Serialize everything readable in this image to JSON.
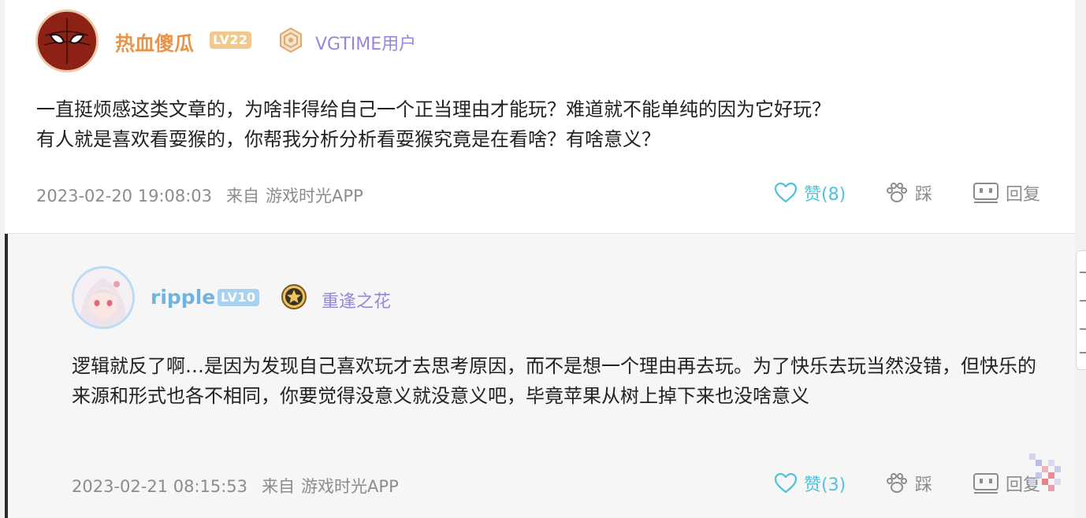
{
  "comments": [
    {
      "username": "热血傻瓜",
      "level": "LV22",
      "group": "VGTIME用户",
      "content": [
        "一直挺烦感这类文章的，为啥非得给自己一个正当理由才能玩？难道就不能单纯的因为它好玩？",
        "有人就是喜欢看耍猴的，你帮我分析分析看耍猴究竟是在看啥？有啥意义？"
      ],
      "timestamp": "2023-02-20 19:08:03",
      "source_prefix": "来自",
      "source_app": "游戏时光APP",
      "like_label": "赞(8)",
      "stamp_label": "踩",
      "reply_label": "回复"
    }
  ],
  "reply": {
    "username": "ripple",
    "level": "LV10",
    "group": "重逢之花",
    "content": "逻辑就反了啊…是因为发现自己喜欢玩才去思考原因，而不是想一个理由再去玩。为了快乐去玩当然没错，但快乐的来源和形式也各不相同，你要觉得没意义就没意义吧，毕竟苹果从树上掉下来也没啥意义",
    "timestamp": "2023-02-21 08:15:53",
    "source_prefix": "来自",
    "source_app": "游戏时光APP",
    "like_label": "赞(3)",
    "stamp_label": "踩",
    "reply_label": "回复"
  },
  "icons": {
    "like": "heart-outline-icon",
    "stamp": "paw-icon",
    "reply": "comment-box-icon"
  },
  "colors": {
    "main_username": "#e8944a",
    "reply_username": "#6fb4de",
    "group": "#9a86d6",
    "like": "#4fc3d9",
    "meta": "#8c8c90",
    "body_text": "#222222"
  }
}
